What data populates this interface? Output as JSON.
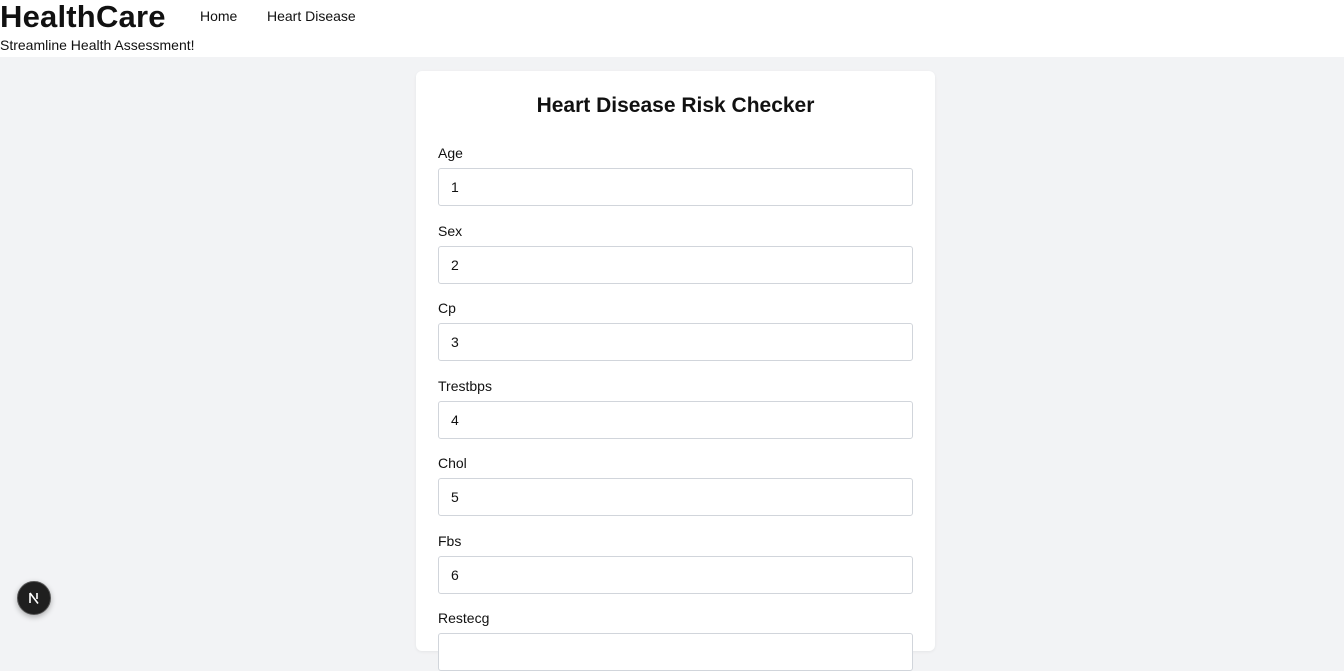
{
  "header": {
    "brand": "HealthCare",
    "tagline": "Streamline Health Assessment!",
    "nav": [
      {
        "label": "Home"
      },
      {
        "label": "Heart Disease"
      }
    ]
  },
  "form": {
    "title": "Heart Disease Risk Checker",
    "fields": [
      {
        "label": "Age",
        "value": "1"
      },
      {
        "label": "Sex",
        "value": "2"
      },
      {
        "label": "Cp",
        "value": "3"
      },
      {
        "label": "Trestbps",
        "value": "4"
      },
      {
        "label": "Chol",
        "value": "5"
      },
      {
        "label": "Fbs",
        "value": "6"
      },
      {
        "label": "Restecg",
        "value": ""
      }
    ]
  },
  "devtools": {
    "icon": "nextjs-icon"
  }
}
